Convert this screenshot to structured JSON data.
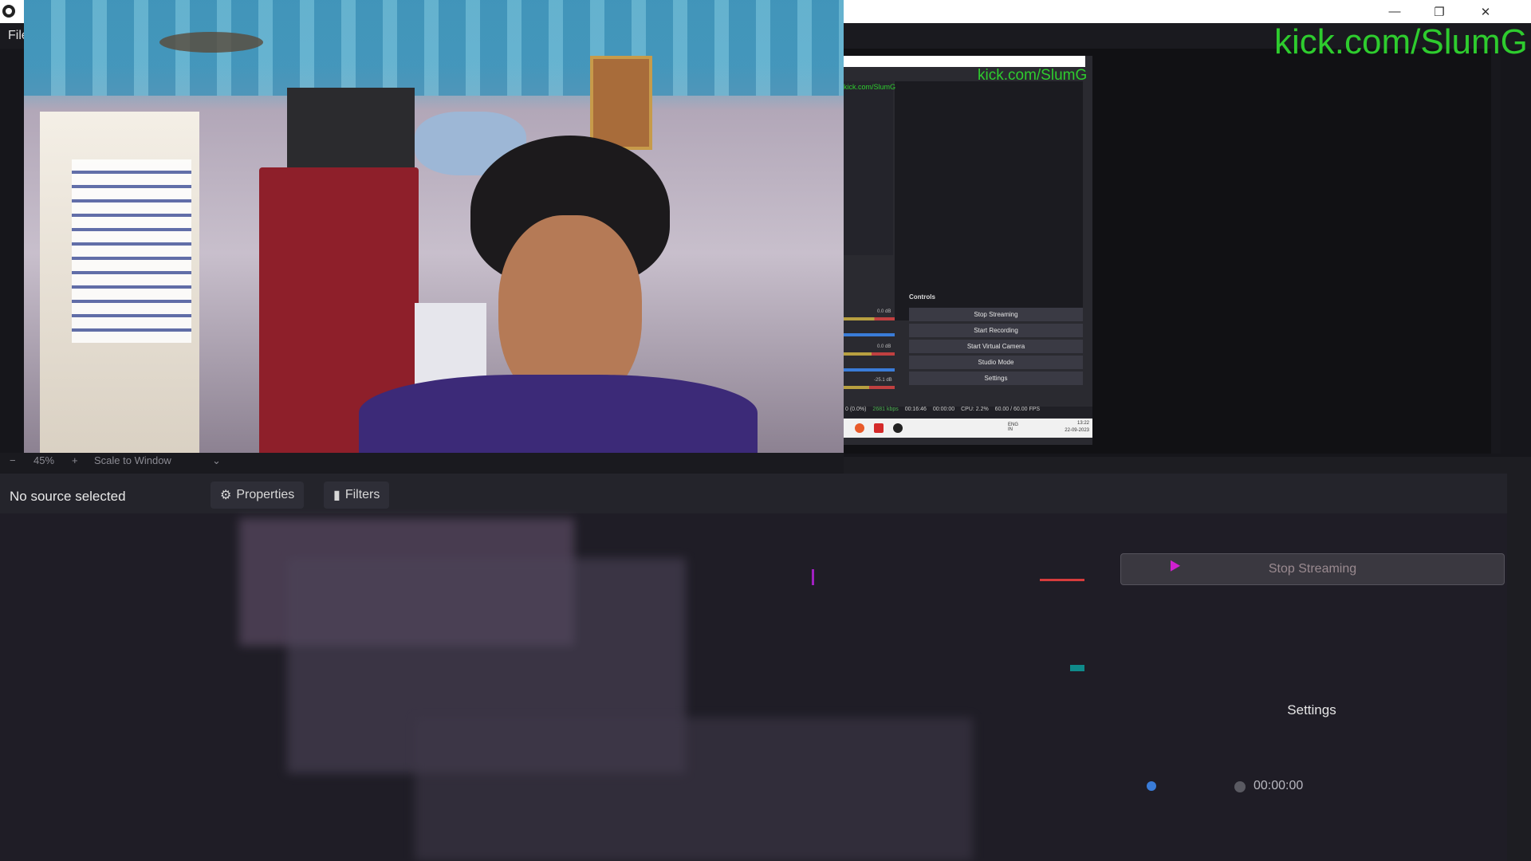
{
  "window": {
    "menu": [
      "File"
    ],
    "controls": {
      "minimize": "—",
      "maximize": "❐",
      "close": "✕"
    }
  },
  "overlay": {
    "kick_text": "kick.com/SlumG"
  },
  "nested_screenshot": {
    "kick_text": "kick.com/SlumG",
    "mini_kick_text": "kick.com/SlumG",
    "controls_title": "Controls",
    "buttons": [
      "Stop Streaming",
      "Start Recording",
      "Start Virtual Camera",
      "Studio Mode",
      "Settings"
    ],
    "db_readouts": [
      "0.0 dB",
      "0.0 dB",
      "-25.1 dB"
    ],
    "status": {
      "dropped": "0 (0.0%)",
      "kbps": "2681 kbps",
      "live_time": "00:16:46",
      "rec_time": "00:00:00",
      "cpu": "CPU: 2.2%",
      "fps": "60.00 / 60.00 FPS"
    },
    "taskbar": {
      "lang": "ENG IN",
      "clock_time": "13:22",
      "clock_date": "22-09-2023"
    }
  },
  "zoom_bar": {
    "minus": "−",
    "zoom": "45%",
    "plus": "+",
    "mode": "Scale to Window"
  },
  "source_bar": {
    "no_source": "No source selected",
    "properties": "Properties",
    "filters": "Filters"
  },
  "controls": {
    "stop_streaming": "Stop Streaming",
    "settings": "Settings"
  },
  "statusbar": {
    "rec_time": "00:00:00"
  },
  "colors": {
    "kick_green": "#2ecc2e",
    "accent": "#d63c3c"
  }
}
